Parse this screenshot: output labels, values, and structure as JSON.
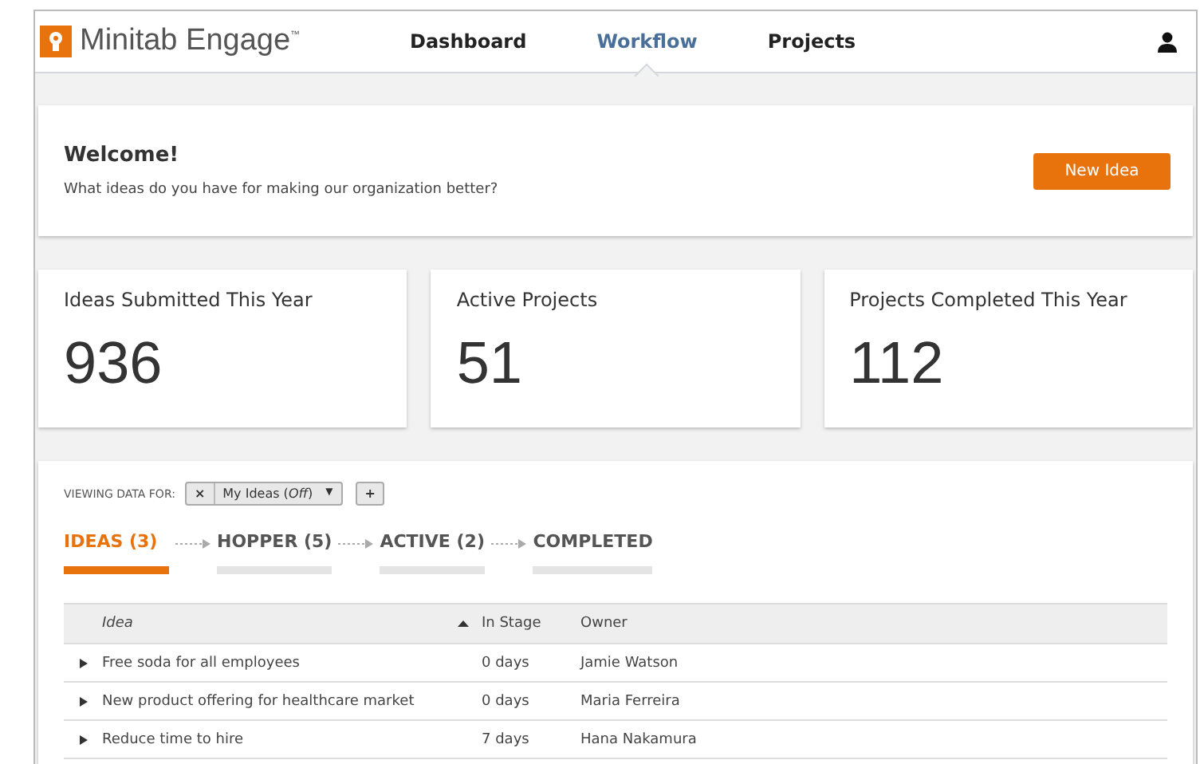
{
  "app": {
    "title": "Minitab Engage$^{™}$"
  },
  "nav": [
    {
      "label": "Dashboard",
      "selected": false
    },
    {
      "label": "Workflow",
      "selected": true
    },
    {
      "label": "Projects",
      "selected": false
    }
  ],
  "welcome": {
    "title": "Welcome!",
    "text": "What ideas do you have for making our organization better?",
    "button": "New Idea"
  },
  "stats": [
    {
      "label": "Ideas Submitted This Year",
      "value": "936"
    },
    {
      "label": "Active Projects",
      "value": "51"
    },
    {
      "label": "Projects Completed This Year",
      "value": "112"
    }
  ],
  "filter": {
    "label": "VIEWING DATA FOR:",
    "remove": "×",
    "value": "My Ideas (*Off*)",
    "caret": "▼",
    "add": "+"
  },
  "stages": [
    {
      "label": "IDEAS (3)",
      "selected": true
    },
    {
      "label": "HOPPER (5)",
      "selected": false
    },
    {
      "label": "ACTIVE (2)",
      "selected": false
    },
    {
      "label": "COMPLETED",
      "selected": false
    }
  ],
  "table": {
    "columns": [
      "Idea",
      "In Stage",
      "Owner"
    ],
    "rows": [
      [
        "Free soda for all employees",
        "0 days",
        "Jamie Watson"
      ],
      [
        "New product offering for healthcare market",
        "0 days",
        "Maria Ferreira"
      ],
      [
        "Reduce time to hire",
        "7 days",
        "Hana Nakamura"
      ]
    ]
  }
}
